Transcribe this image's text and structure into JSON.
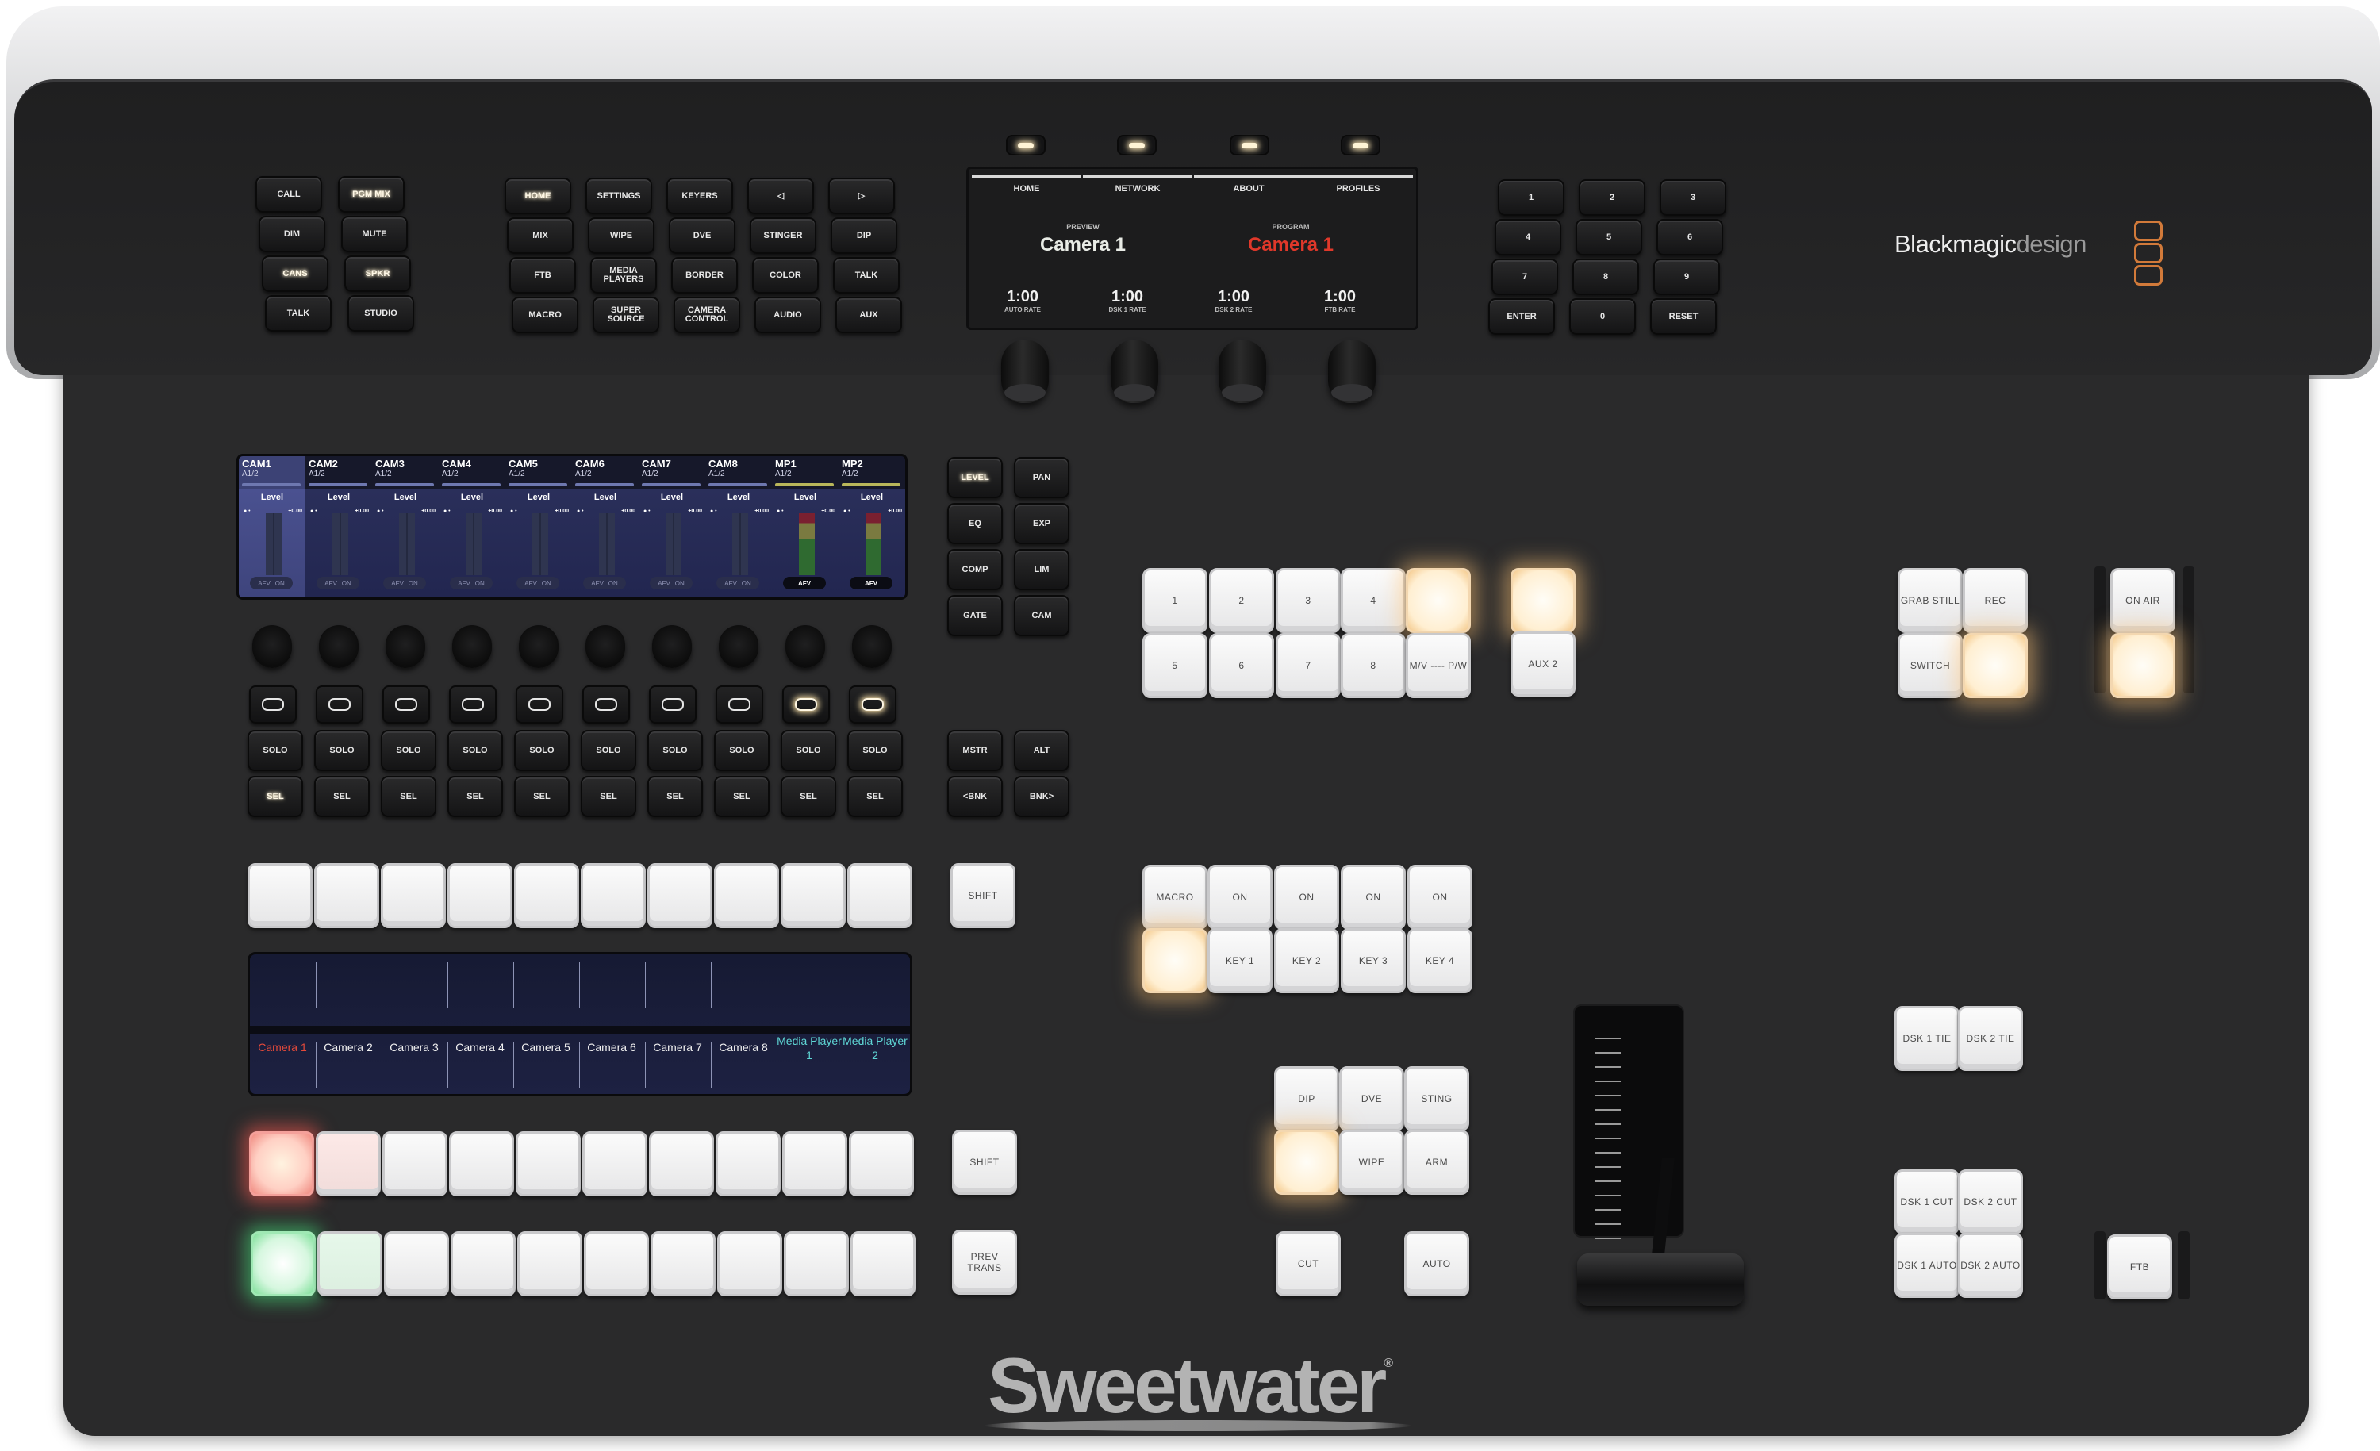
{
  "brand": {
    "logo_bold": "Blackmagic",
    "logo_light": "design",
    "watermark": "Sweetwater",
    "watermark_reg": "®",
    "accent_color": "#c8682c"
  },
  "talkback": {
    "keys": [
      {
        "label": "CALL",
        "lit": false
      },
      {
        "label": "PGM MIX",
        "lit": true
      },
      {
        "label": "DIM",
        "lit": false
      },
      {
        "label": "MUTE",
        "lit": false
      },
      {
        "label": "CANS",
        "lit": true
      },
      {
        "label": "SPKR",
        "lit": true
      },
      {
        "label": "TALK",
        "lit": false
      },
      {
        "label": "STUDIO",
        "lit": false
      }
    ]
  },
  "menu_keys": [
    {
      "label": "HOME",
      "lit": true
    },
    {
      "label": "SETTINGS",
      "lit": false
    },
    {
      "label": "KEYERS",
      "lit": false
    },
    {
      "label": "◁",
      "lit": false
    },
    {
      "label": "▷",
      "lit": false
    },
    {
      "label": "MIX",
      "lit": false
    },
    {
      "label": "WIPE",
      "lit": false
    },
    {
      "label": "DVE",
      "lit": false
    },
    {
      "label": "STINGER",
      "lit": false
    },
    {
      "label": "DIP",
      "lit": false
    },
    {
      "label": "FTB",
      "lit": false
    },
    {
      "label": "MEDIA PLAYERS",
      "lit": false
    },
    {
      "label": "BORDER",
      "lit": false
    },
    {
      "label": "COLOR",
      "lit": false
    },
    {
      "label": "TALK",
      "lit": false
    },
    {
      "label": "MACRO",
      "lit": false
    },
    {
      "label": "SUPER SOURCE",
      "lit": false
    },
    {
      "label": "CAMERA CONTROL",
      "lit": false
    },
    {
      "label": "AUDIO",
      "lit": false
    },
    {
      "label": "AUX",
      "lit": false
    }
  ],
  "lcd": {
    "tabs": [
      {
        "label": "HOME",
        "active": true
      },
      {
        "label": "NETWORK",
        "active": false
      },
      {
        "label": "ABOUT",
        "active": false
      },
      {
        "label": "PROFILES",
        "active": false
      }
    ],
    "preview_label": "PREVIEW",
    "preview_source": "Camera 1",
    "program_label": "PROGRAM",
    "program_source": "Camera 1",
    "program_color": "#e0382a",
    "rates": [
      {
        "value": "1:00",
        "label": "AUTO RATE"
      },
      {
        "value": "1:00",
        "label": "DSK 1 RATE"
      },
      {
        "value": "1:00",
        "label": "DSK 2 RATE"
      },
      {
        "value": "1:00",
        "label": "FTB RATE"
      }
    ]
  },
  "keypad": [
    "1",
    "2",
    "3",
    "4",
    "5",
    "6",
    "7",
    "8",
    "9",
    "ENTER",
    "0",
    "RESET"
  ],
  "audio": {
    "channels": [
      {
        "name": "CAM1",
        "sub": "A1/2",
        "level_label": "Level",
        "gain": "+0.00",
        "afv": "AFV",
        "on": "ON",
        "afv_on": false,
        "selected": true,
        "meter_active": false
      },
      {
        "name": "CAM2",
        "sub": "A1/2",
        "level_label": "Level",
        "gain": "+0.00",
        "afv": "AFV",
        "on": "ON",
        "afv_on": false,
        "selected": false,
        "meter_active": false
      },
      {
        "name": "CAM3",
        "sub": "A1/2",
        "level_label": "Level",
        "gain": "+0.00",
        "afv": "AFV",
        "on": "ON",
        "afv_on": false,
        "selected": false,
        "meter_active": false
      },
      {
        "name": "CAM4",
        "sub": "A1/2",
        "level_label": "Level",
        "gain": "+0.00",
        "afv": "AFV",
        "on": "ON",
        "afv_on": false,
        "selected": false,
        "meter_active": false
      },
      {
        "name": "CAM5",
        "sub": "A1/2",
        "level_label": "Level",
        "gain": "+0.00",
        "afv": "AFV",
        "on": "ON",
        "afv_on": false,
        "selected": false,
        "meter_active": false
      },
      {
        "name": "CAM6",
        "sub": "A1/2",
        "level_label": "Level",
        "gain": "+0.00",
        "afv": "AFV",
        "on": "ON",
        "afv_on": false,
        "selected": false,
        "meter_active": false
      },
      {
        "name": "CAM7",
        "sub": "A1/2",
        "level_label": "Level",
        "gain": "+0.00",
        "afv": "AFV",
        "on": "ON",
        "afv_on": false,
        "selected": false,
        "meter_active": false
      },
      {
        "name": "CAM8",
        "sub": "A1/2",
        "level_label": "Level",
        "gain": "+0.00",
        "afv": "AFV",
        "on": "ON",
        "afv_on": false,
        "selected": false,
        "meter_active": false
      },
      {
        "name": "MP1",
        "sub": "A1/2",
        "level_label": "Level",
        "gain": "+0.00",
        "afv": "AFV",
        "on": "",
        "afv_on": true,
        "selected": false,
        "meter_active": true
      },
      {
        "name": "MP2",
        "sub": "A1/2",
        "level_label": "Level",
        "gain": "+0.00",
        "afv": "AFV",
        "on": "",
        "afv_on": true,
        "selected": false,
        "meter_active": true
      }
    ],
    "solo_label": "SOLO",
    "sel_label": "SEL",
    "function_keys": [
      {
        "label": "LEVEL",
        "lit": true
      },
      {
        "label": "PAN",
        "lit": false
      },
      {
        "label": "EQ",
        "lit": false
      },
      {
        "label": "EXP",
        "lit": false
      },
      {
        "label": "COMP",
        "lit": false
      },
      {
        "label": "LIM",
        "lit": false
      },
      {
        "label": "GATE",
        "lit": false
      },
      {
        "label": "CAM",
        "lit": false
      }
    ],
    "bank_keys": [
      "MSTR",
      "ALT",
      "<BNK",
      "BNK>"
    ]
  },
  "sources": {
    "names": [
      {
        "label": "Camera 1",
        "color": "red"
      },
      {
        "label": "Camera 2",
        "color": "white"
      },
      {
        "label": "Camera 3",
        "color": "white"
      },
      {
        "label": "Camera 4",
        "color": "white"
      },
      {
        "label": "Camera 5",
        "color": "white"
      },
      {
        "label": "Camera 6",
        "color": "white"
      },
      {
        "label": "Camera 7",
        "color": "white"
      },
      {
        "label": "Camera 8",
        "color": "white"
      },
      {
        "label": "Media Player 1",
        "color": "cyan"
      },
      {
        "label": "Media Player 2",
        "color": "cyan"
      }
    ],
    "program_active_index": 0,
    "preview_active_index": 0
  },
  "shift_label": "SHIFT",
  "prev_trans_label": "PREV TRANS",
  "aux": {
    "keys": [
      "1",
      "2",
      "3",
      "4",
      "",
      "5",
      "6",
      "7",
      "8",
      "M/V ---- P/W"
    ],
    "aux2_label": "AUX 2"
  },
  "record": {
    "grab_still": "GRAB STILL",
    "rec": "REC",
    "switch": "SWITCH",
    "on_air": "ON AIR"
  },
  "keyers": {
    "macro": "MACRO",
    "on": "ON",
    "keys": [
      "KEY 1",
      "KEY 2",
      "KEY 3",
      "KEY 4"
    ]
  },
  "transitions": {
    "dip": "DIP",
    "dve": "DVE",
    "sting": "STING",
    "wipe": "WIPE",
    "arm": "ARM",
    "cut": "CUT",
    "auto": "AUTO"
  },
  "dsk": {
    "tie1": "DSK 1 TIE",
    "tie2": "DSK 2 TIE",
    "cut1": "DSK 1 CUT",
    "cut2": "DSK 2 CUT",
    "auto1": "DSK 1 AUTO",
    "auto2": "DSK 2 AUTO",
    "ftb": "FTB"
  },
  "tbar": {
    "position": 0.0
  }
}
